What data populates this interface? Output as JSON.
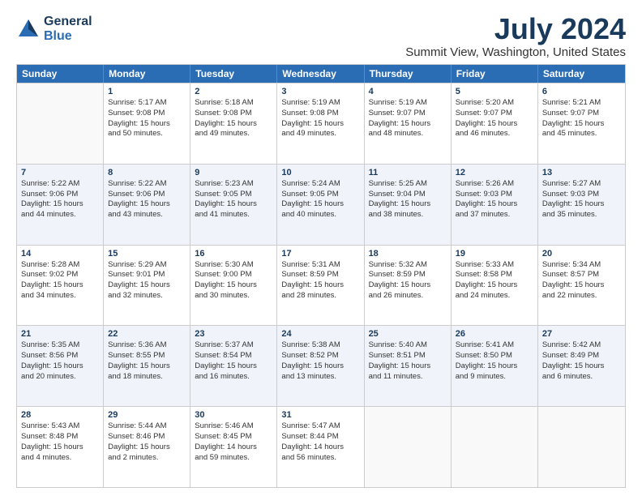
{
  "logo": {
    "line1": "General",
    "line2": "Blue"
  },
  "title": "July 2024",
  "location": "Summit View, Washington, United States",
  "headers": [
    "Sunday",
    "Monday",
    "Tuesday",
    "Wednesday",
    "Thursday",
    "Friday",
    "Saturday"
  ],
  "rows": [
    [
      {
        "day": "",
        "lines": []
      },
      {
        "day": "1",
        "lines": [
          "Sunrise: 5:17 AM",
          "Sunset: 9:08 PM",
          "Daylight: 15 hours",
          "and 50 minutes."
        ]
      },
      {
        "day": "2",
        "lines": [
          "Sunrise: 5:18 AM",
          "Sunset: 9:08 PM",
          "Daylight: 15 hours",
          "and 49 minutes."
        ]
      },
      {
        "day": "3",
        "lines": [
          "Sunrise: 5:19 AM",
          "Sunset: 9:08 PM",
          "Daylight: 15 hours",
          "and 49 minutes."
        ]
      },
      {
        "day": "4",
        "lines": [
          "Sunrise: 5:19 AM",
          "Sunset: 9:07 PM",
          "Daylight: 15 hours",
          "and 48 minutes."
        ]
      },
      {
        "day": "5",
        "lines": [
          "Sunrise: 5:20 AM",
          "Sunset: 9:07 PM",
          "Daylight: 15 hours",
          "and 46 minutes."
        ]
      },
      {
        "day": "6",
        "lines": [
          "Sunrise: 5:21 AM",
          "Sunset: 9:07 PM",
          "Daylight: 15 hours",
          "and 45 minutes."
        ]
      }
    ],
    [
      {
        "day": "7",
        "lines": [
          "Sunrise: 5:22 AM",
          "Sunset: 9:06 PM",
          "Daylight: 15 hours",
          "and 44 minutes."
        ]
      },
      {
        "day": "8",
        "lines": [
          "Sunrise: 5:22 AM",
          "Sunset: 9:06 PM",
          "Daylight: 15 hours",
          "and 43 minutes."
        ]
      },
      {
        "day": "9",
        "lines": [
          "Sunrise: 5:23 AM",
          "Sunset: 9:05 PM",
          "Daylight: 15 hours",
          "and 41 minutes."
        ]
      },
      {
        "day": "10",
        "lines": [
          "Sunrise: 5:24 AM",
          "Sunset: 9:05 PM",
          "Daylight: 15 hours",
          "and 40 minutes."
        ]
      },
      {
        "day": "11",
        "lines": [
          "Sunrise: 5:25 AM",
          "Sunset: 9:04 PM",
          "Daylight: 15 hours",
          "and 38 minutes."
        ]
      },
      {
        "day": "12",
        "lines": [
          "Sunrise: 5:26 AM",
          "Sunset: 9:03 PM",
          "Daylight: 15 hours",
          "and 37 minutes."
        ]
      },
      {
        "day": "13",
        "lines": [
          "Sunrise: 5:27 AM",
          "Sunset: 9:03 PM",
          "Daylight: 15 hours",
          "and 35 minutes."
        ]
      }
    ],
    [
      {
        "day": "14",
        "lines": [
          "Sunrise: 5:28 AM",
          "Sunset: 9:02 PM",
          "Daylight: 15 hours",
          "and 34 minutes."
        ]
      },
      {
        "day": "15",
        "lines": [
          "Sunrise: 5:29 AM",
          "Sunset: 9:01 PM",
          "Daylight: 15 hours",
          "and 32 minutes."
        ]
      },
      {
        "day": "16",
        "lines": [
          "Sunrise: 5:30 AM",
          "Sunset: 9:00 PM",
          "Daylight: 15 hours",
          "and 30 minutes."
        ]
      },
      {
        "day": "17",
        "lines": [
          "Sunrise: 5:31 AM",
          "Sunset: 8:59 PM",
          "Daylight: 15 hours",
          "and 28 minutes."
        ]
      },
      {
        "day": "18",
        "lines": [
          "Sunrise: 5:32 AM",
          "Sunset: 8:59 PM",
          "Daylight: 15 hours",
          "and 26 minutes."
        ]
      },
      {
        "day": "19",
        "lines": [
          "Sunrise: 5:33 AM",
          "Sunset: 8:58 PM",
          "Daylight: 15 hours",
          "and 24 minutes."
        ]
      },
      {
        "day": "20",
        "lines": [
          "Sunrise: 5:34 AM",
          "Sunset: 8:57 PM",
          "Daylight: 15 hours",
          "and 22 minutes."
        ]
      }
    ],
    [
      {
        "day": "21",
        "lines": [
          "Sunrise: 5:35 AM",
          "Sunset: 8:56 PM",
          "Daylight: 15 hours",
          "and 20 minutes."
        ]
      },
      {
        "day": "22",
        "lines": [
          "Sunrise: 5:36 AM",
          "Sunset: 8:55 PM",
          "Daylight: 15 hours",
          "and 18 minutes."
        ]
      },
      {
        "day": "23",
        "lines": [
          "Sunrise: 5:37 AM",
          "Sunset: 8:54 PM",
          "Daylight: 15 hours",
          "and 16 minutes."
        ]
      },
      {
        "day": "24",
        "lines": [
          "Sunrise: 5:38 AM",
          "Sunset: 8:52 PM",
          "Daylight: 15 hours",
          "and 13 minutes."
        ]
      },
      {
        "day": "25",
        "lines": [
          "Sunrise: 5:40 AM",
          "Sunset: 8:51 PM",
          "Daylight: 15 hours",
          "and 11 minutes."
        ]
      },
      {
        "day": "26",
        "lines": [
          "Sunrise: 5:41 AM",
          "Sunset: 8:50 PM",
          "Daylight: 15 hours",
          "and 9 minutes."
        ]
      },
      {
        "day": "27",
        "lines": [
          "Sunrise: 5:42 AM",
          "Sunset: 8:49 PM",
          "Daylight: 15 hours",
          "and 6 minutes."
        ]
      }
    ],
    [
      {
        "day": "28",
        "lines": [
          "Sunrise: 5:43 AM",
          "Sunset: 8:48 PM",
          "Daylight: 15 hours",
          "and 4 minutes."
        ]
      },
      {
        "day": "29",
        "lines": [
          "Sunrise: 5:44 AM",
          "Sunset: 8:46 PM",
          "Daylight: 15 hours",
          "and 2 minutes."
        ]
      },
      {
        "day": "30",
        "lines": [
          "Sunrise: 5:46 AM",
          "Sunset: 8:45 PM",
          "Daylight: 14 hours",
          "and 59 minutes."
        ]
      },
      {
        "day": "31",
        "lines": [
          "Sunrise: 5:47 AM",
          "Sunset: 8:44 PM",
          "Daylight: 14 hours",
          "and 56 minutes."
        ]
      },
      {
        "day": "",
        "lines": []
      },
      {
        "day": "",
        "lines": []
      },
      {
        "day": "",
        "lines": []
      }
    ]
  ]
}
